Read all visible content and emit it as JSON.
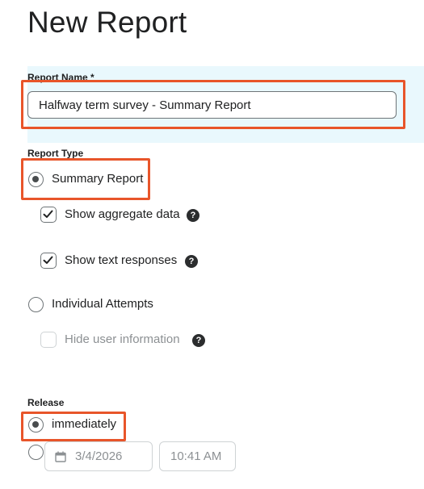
{
  "page": {
    "title": "New Report"
  },
  "report_name": {
    "label": "Report Name *",
    "value": "Halfway term survey - Summary Report"
  },
  "report_type": {
    "label": "Report Type",
    "summary": {
      "label": "Summary Report",
      "selected": true,
      "options": {
        "aggregate": {
          "label": "Show aggregate data",
          "checked": true
        },
        "text_responses": {
          "label": "Show text responses",
          "checked": true
        }
      }
    },
    "individual": {
      "label": "Individual Attempts",
      "selected": false,
      "options": {
        "hide_user": {
          "label": "Hide user information",
          "checked": false,
          "disabled": true
        }
      }
    }
  },
  "release": {
    "label": "Release",
    "immediately": {
      "label": "immediately",
      "selected": true
    },
    "scheduled": {
      "selected": false,
      "date": "3/4/2026",
      "time": "10:41 AM"
    }
  },
  "icons": {
    "help": "?",
    "check": "checkmark-icon",
    "calendar": "calendar-icon"
  },
  "colors": {
    "highlight": "#e8552a",
    "panel_bg": "#e9f8fd",
    "text": "#202122",
    "muted": "#8c9093"
  }
}
